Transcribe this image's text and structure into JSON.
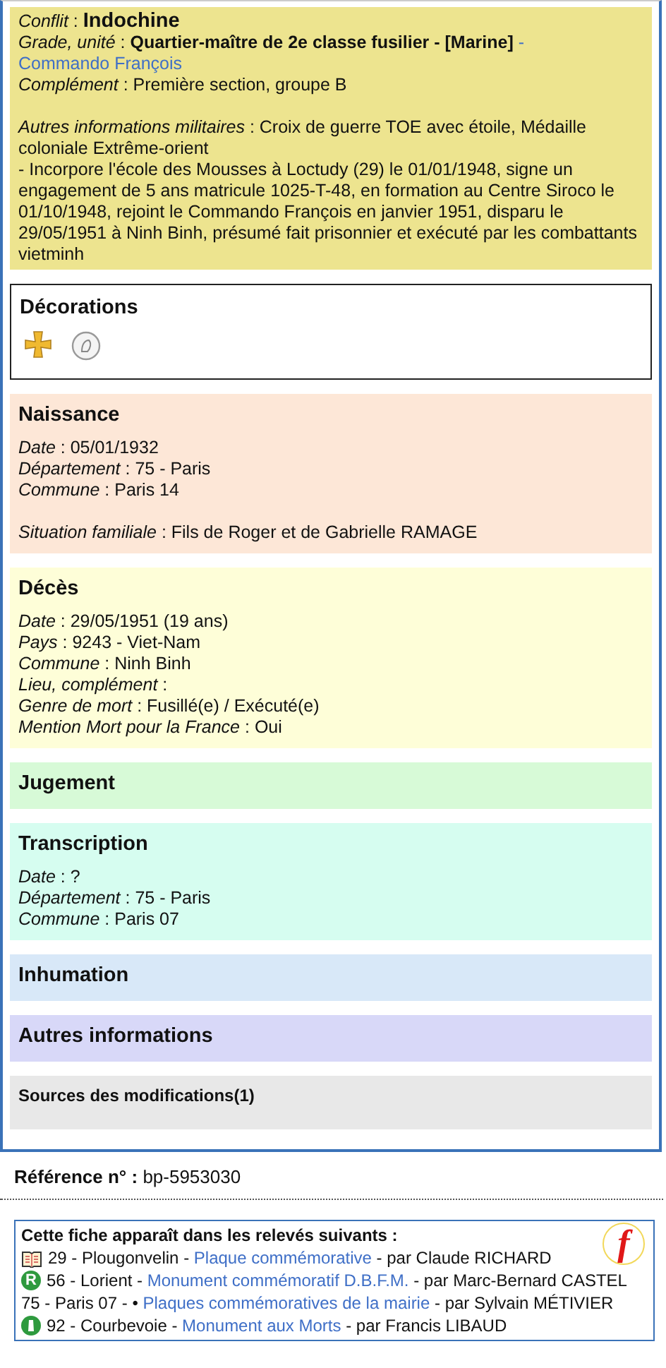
{
  "military": {
    "color": "#ede48f",
    "conflict": {
      "label": "Conflit",
      "value": ": ",
      "strong": "Indochine"
    },
    "grade": {
      "label": "Grade, unité",
      "value": ": ",
      "strong": "Quartier-maître de 2e classe fusilier - [Marine]",
      "separator": " - ",
      "link": "Commando François"
    },
    "fields": [
      {
        "label": "Complément",
        "value": ": Première section, groupe B"
      }
    ],
    "other": {
      "label": "Autres informations militaires",
      "value": ": Croix de guerre TOE avec étoile, Médaille coloniale Extrême-orient"
    },
    "note": "- Incorpore l'école des Mousses à Loctudy (29) le 01/01/1948, signe un engagement de 5 ans matricule 1025-T-48, en formation au Centre Siroco le 01/10/1948, rejoint le Commando François en janvier 1951, disparu le 29/05/1951 à Ninh Binh, présumé fait prisonnier et exécuté par les combattants vietminh"
  },
  "decorations": {
    "title": "Décorations",
    "items": [
      {
        "kind": "cross"
      },
      {
        "kind": "medal"
      }
    ]
  },
  "sections": [
    {
      "title": "Naissance",
      "color": "#fde7d7",
      "groups": [
        [
          {
            "label": "Date",
            "value": ": 05/01/1932"
          },
          {
            "label": "Département",
            "value": ": 75 - Paris"
          },
          {
            "label": "Commune",
            "value": ": Paris 14"
          }
        ],
        [
          {
            "label": "Situation familiale",
            "value": ": Fils de Roger et de Gabrielle RAMAGE"
          }
        ]
      ]
    },
    {
      "title": "Décès",
      "color": "#fefed8",
      "groups": [
        [
          {
            "label": "Date",
            "value": ": 29/05/1951  (19 ans)"
          },
          {
            "label": "Pays",
            "value": ": 9243 - Viet-Nam"
          },
          {
            "label": "Commune",
            "value": ": Ninh Binh"
          },
          {
            "label": "Lieu, complément",
            "value": ":"
          },
          {
            "label": "Genre de mort",
            "value": ": Fusillé(e) / Exécuté(e)"
          },
          {
            "label": "Mention Mort pour la France",
            "value": ": Oui"
          }
        ]
      ]
    },
    {
      "title": "Jugement",
      "color": "#d7fad7"
    },
    {
      "title": "Transcription",
      "color": "#d6fdf0",
      "groups": [
        [
          {
            "label": "Date",
            "value": ": ?"
          },
          {
            "label": "Département",
            "value": ": 75 - Paris"
          },
          {
            "label": "Commune",
            "value": ": Paris 07"
          }
        ]
      ]
    },
    {
      "title": "Inhumation",
      "color": "#d8e8f8"
    },
    {
      "title": "Autres informations",
      "color": "#d8d8f8"
    }
  ],
  "sources": {
    "title": "Sources des modifications(1)",
    "color": "#e8e8e8"
  },
  "reference": {
    "label": "Référence n° :",
    "value": "bp-5953030"
  },
  "releves": {
    "title": "Cette fiche apparaît dans les relevés suivants :",
    "logo": "f",
    "items": [
      {
        "kind": "book",
        "prefix": "29 - Plougonvelin - ",
        "link": "Plaque commémorative",
        "suffix": " - par Claude RICHARD"
      },
      {
        "kind": "badge",
        "badge": "R",
        "prefix": "56 - Lorient - ",
        "link": "Monument commémoratif D.B.F.M.",
        "suffix": " - par Marc-Bernard CASTEL"
      },
      {
        "kind": "plain",
        "prefix": "75 - Paris 07 - • ",
        "link": "Plaques commémoratives de la mairie",
        "suffix": " - par Sylvain MÉTIVIER"
      },
      {
        "kind": "monument",
        "prefix": "92 - Courbevoie - ",
        "link": "Monument aux Morts",
        "suffix": " - par Francis LIBAUD"
      }
    ]
  }
}
